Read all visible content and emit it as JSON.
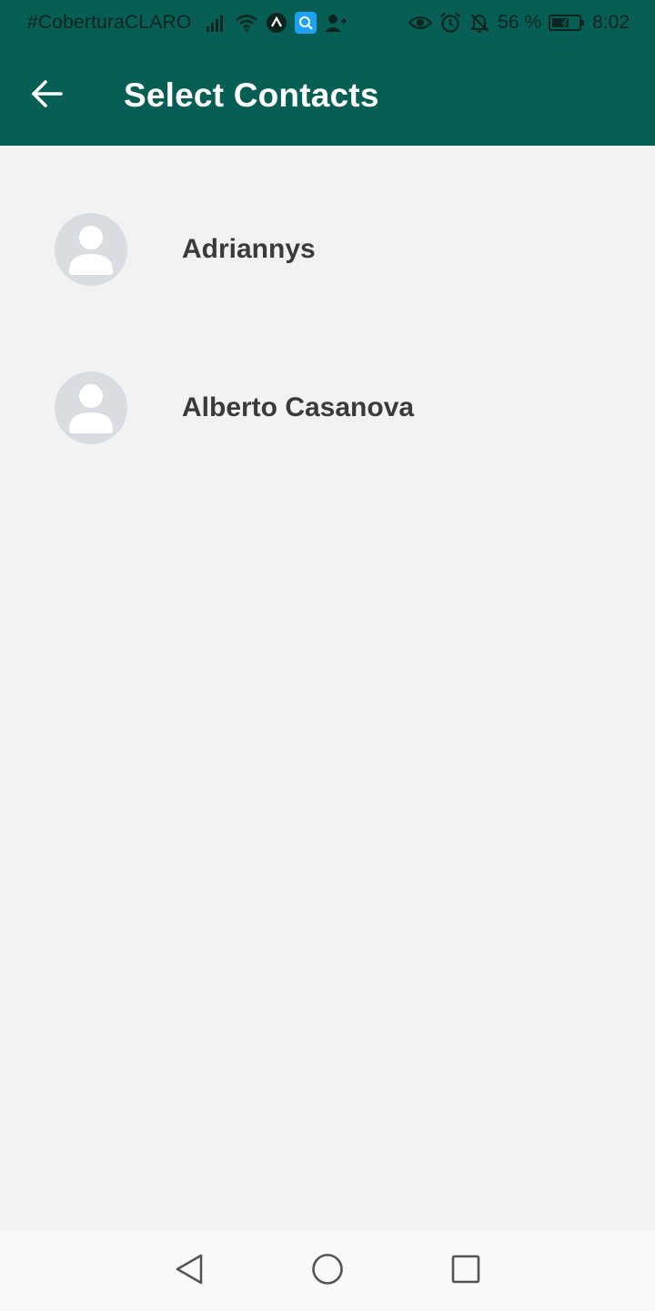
{
  "status_bar": {
    "carrier": "#CoberturaCLARO",
    "battery_percent": "56 %",
    "time": "8:02",
    "icons": [
      "signal-icon",
      "wifi-icon",
      "app-a-icon",
      "search-app-icon",
      "add-contact-icon",
      "eye-icon",
      "alarm-icon",
      "bell-off-icon",
      "battery-icon"
    ]
  },
  "app_bar": {
    "back_icon": "arrow-left-icon",
    "title": "Select Contacts",
    "color": "#075e54"
  },
  "contacts": [
    {
      "name": "Adriannys",
      "avatar_icon": "default-avatar-icon"
    },
    {
      "name": "Alberto Casanova",
      "avatar_icon": "default-avatar-icon"
    }
  ],
  "nav_bar": {
    "buttons": [
      "back-triangle-icon",
      "home-circle-icon",
      "recents-square-icon"
    ]
  }
}
